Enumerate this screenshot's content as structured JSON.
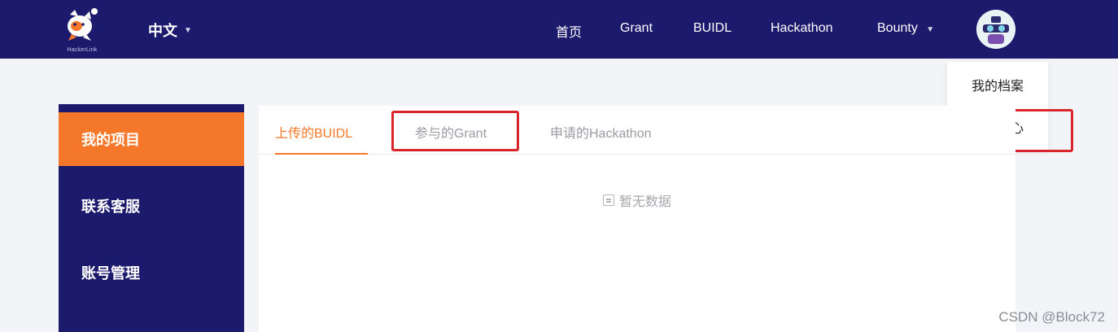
{
  "header": {
    "logo_text": "HackerLink",
    "language": "中文",
    "nav": [
      "首页",
      "Grant",
      "BUIDL",
      "Hackathon",
      "Bounty"
    ],
    "brand_color": "#1c1a6c"
  },
  "profile_menu": {
    "items": [
      "我的档案",
      "个人中心"
    ],
    "highlighted_item": "个人中心"
  },
  "sidebar": {
    "items": [
      "我的项目",
      "联系客服",
      "账号管理"
    ],
    "active_item": "我的项目",
    "active_color": "#f5782a"
  },
  "main": {
    "tabs": [
      "上传的BUIDL",
      "参与的Grant",
      "申请的Hackathon"
    ],
    "active_tab": "上传的BUIDL",
    "highlighted_tab": "参与的Grant",
    "empty_text": "暂无数据"
  },
  "watermark": "CSDN @Block72",
  "icons": {
    "logo": "cat-mascot-icon",
    "avatar": "user-avatar-icon",
    "dropdown": "chevron-down-icon",
    "empty": "empty-document-icon"
  }
}
